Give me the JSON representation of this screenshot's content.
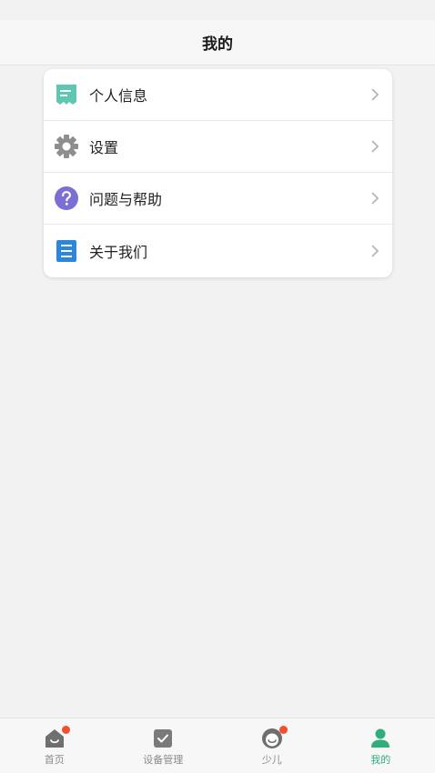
{
  "header": {
    "title": "我的"
  },
  "menu": {
    "items": [
      {
        "label": "个人信息",
        "icon": "receipt-icon",
        "color": "#5fc6b3"
      },
      {
        "label": "设置",
        "icon": "gear-icon",
        "color": "#8e8e8e"
      },
      {
        "label": "问题与帮助",
        "icon": "question-icon",
        "color": "#7b6fd6"
      },
      {
        "label": "关于我们",
        "icon": "document-list-icon",
        "color": "#2c86db"
      }
    ]
  },
  "tabbar": {
    "tabs": [
      {
        "label": "首页",
        "icon": "home-icon",
        "badge": true
      },
      {
        "label": "设备管理",
        "icon": "device-check-icon",
        "badge": false
      },
      {
        "label": "少儿",
        "icon": "child-face-icon",
        "badge": true
      },
      {
        "label": "我的",
        "icon": "profile-icon",
        "badge": false,
        "active": true
      }
    ]
  },
  "colors": {
    "accent": "#2fae7c",
    "badge": "#f0502d",
    "inactive": "#8a8a8a"
  }
}
